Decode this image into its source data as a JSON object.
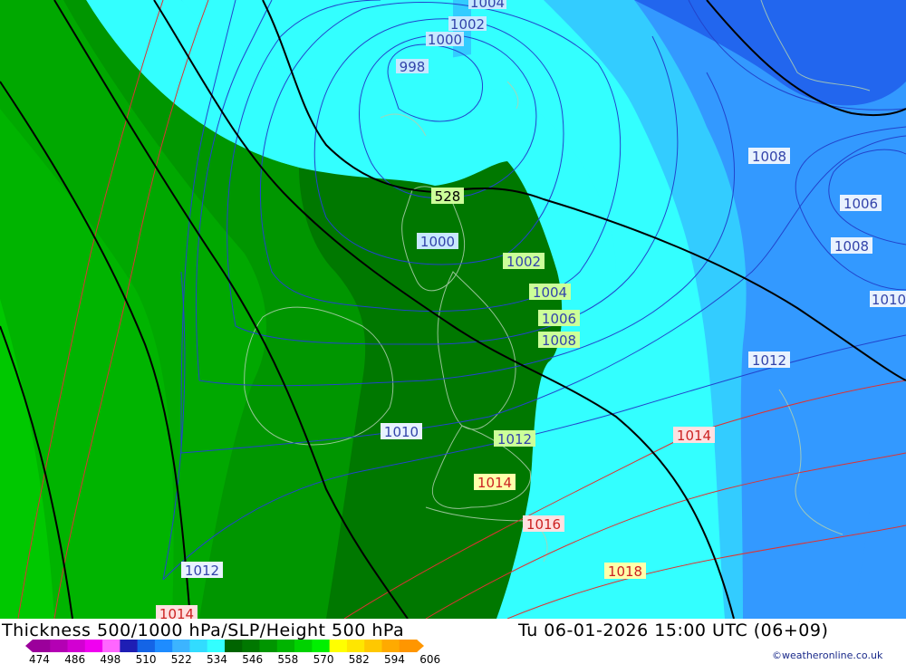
{
  "title": "Thickness 500/1000 hPa/SLP/Height 500 hPa",
  "valid_time": "Tu 06-01-2026 15:00 UTC (06+09)",
  "credit": "©weatheronline.co.uk",
  "colors": {
    "green_dark": "#007800",
    "green_mid": "#009600",
    "green_light": "#00b400",
    "green_bright": "#00c800",
    "cyan": "#33ffff",
    "blue_light": "#33ccff",
    "blue_mid": "#3399ff",
    "blue_deep": "#2266ee",
    "isobar_blue": "#2244cc",
    "isobar_red": "#dd3333",
    "height_line": "#000000"
  },
  "scale": {
    "labels": [
      "474",
      "486",
      "498",
      "510",
      "522",
      "534",
      "546",
      "558",
      "570",
      "582",
      "594",
      "606"
    ],
    "colors": [
      "#9b009b",
      "#b400b4",
      "#d200d2",
      "#f000f0",
      "#ff66ff",
      "#1e1eb4",
      "#1464e6",
      "#1e8cff",
      "#3cb4ff",
      "#32dcff",
      "#33ffff",
      "#006400",
      "#007800",
      "#009600",
      "#00b400",
      "#00d200",
      "#00f000",
      "#ffff00",
      "#ffe600",
      "#ffc800",
      "#ffaa00",
      "#ff9600"
    ]
  },
  "labels": {
    "p1004_top": "1004",
    "p1002_top": "1002",
    "p1000_top": "1000",
    "p998": "998",
    "p1008_ne": "1008",
    "p1006_ne": "1006",
    "p1008_e": "1008",
    "p1010_e": "1010",
    "h528": "528",
    "p1000_scot": "1000",
    "p1002": "1002",
    "p1004": "1004",
    "p1006": "1006",
    "p1008": "1008",
    "p1012_e": "1012",
    "p1010": "1010",
    "p1012_mid": "1012",
    "p1014_e": "1014",
    "p1014_mid": "1014",
    "p1016": "1016",
    "p1018": "1018",
    "p1012_sw": "1012",
    "p1014_sw": "1014"
  }
}
